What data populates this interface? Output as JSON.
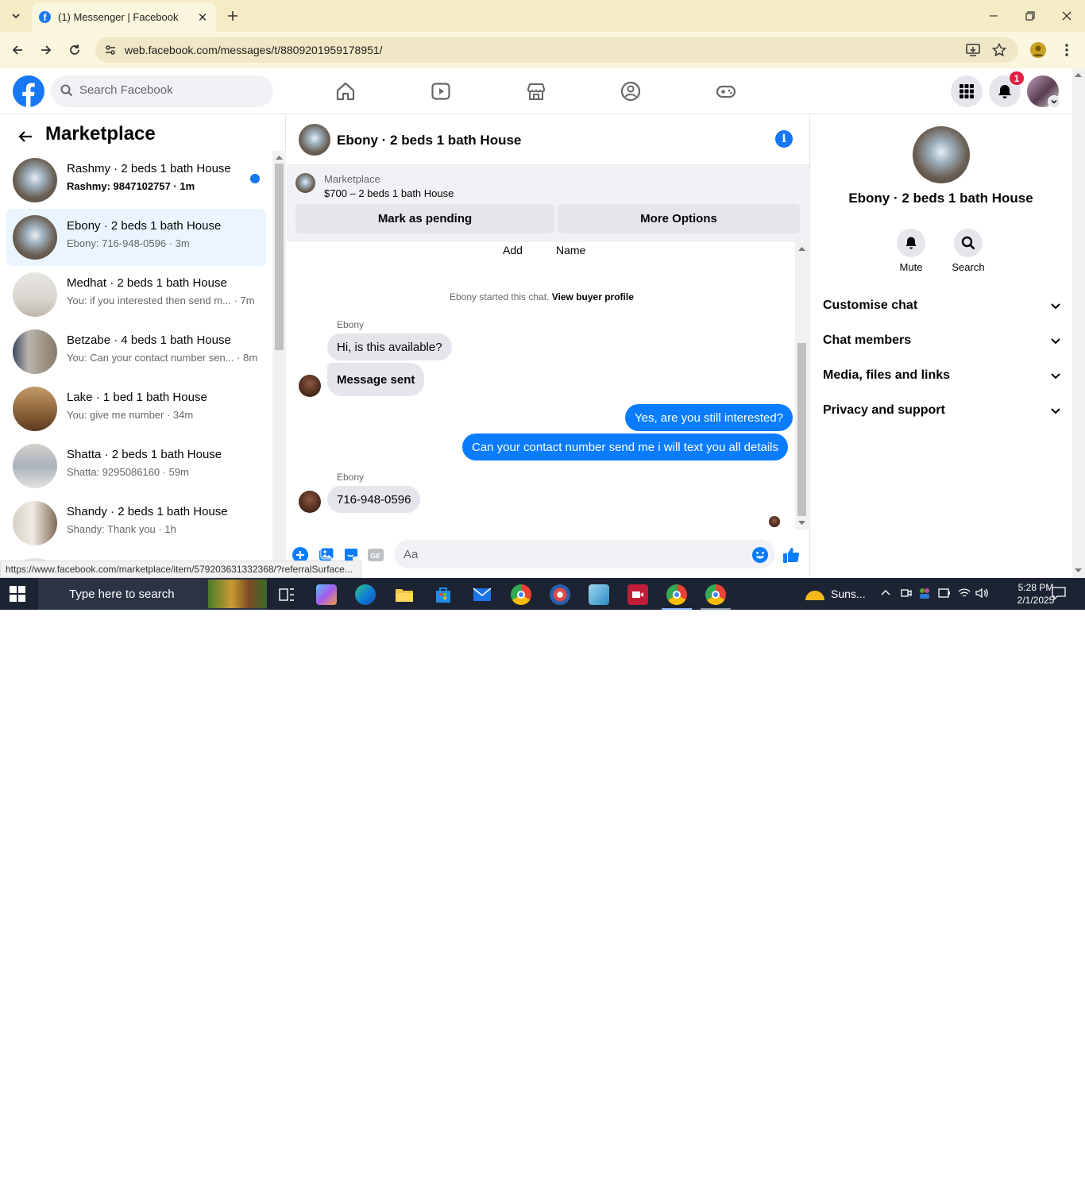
{
  "browser": {
    "tab_title": "(1) Messenger | Facebook",
    "url": "web.facebook.com/messages/t/8809201959178951/",
    "status_link": "https://www.facebook.com/marketplace/item/579203631332368/?referralSurface..."
  },
  "header": {
    "search_placeholder": "Search Facebook",
    "notification_count": "1"
  },
  "sidebar": {
    "title": "Marketplace",
    "conversations": [
      {
        "name": "Rashmy · 2 beds 1 bath House",
        "snippet": "Rashmy: 9847102757 · 1m",
        "unread": true
      },
      {
        "name": "Ebony · 2 beds 1 bath House",
        "snippet": "Ebony: 716-948-0596 · 3m",
        "selected": true
      },
      {
        "name": "Medhat · 2 beds 1 bath House",
        "snippet": "You: if you interested then send m... · 7m"
      },
      {
        "name": "Betzabe · 4 beds 1 bath House",
        "snippet": "You: Can your contact number sen... · 8m"
      },
      {
        "name": "Lake · 1 bed 1 bath House",
        "snippet": "You: give me number · 34m"
      },
      {
        "name": "Shatta · 2 beds 1 bath House",
        "snippet": "Shatta: 9295086160 · 59m"
      },
      {
        "name": "Shandy · 2 beds 1 bath House",
        "snippet": "Shandy: Thank you · 1h"
      }
    ]
  },
  "chat": {
    "title": "Ebony · 2 beds 1 bath House",
    "marketplace_label": "Marketplace",
    "listing": "$700 – 2 beds 1 bath House",
    "mark_pending": "Mark as pending",
    "more_options": "More Options",
    "top_labels": {
      "add": "Add",
      "name": "Name"
    },
    "started_text": "Ebony started this chat.",
    "view_profile": "View buyer profile",
    "sender": "Ebony",
    "messages": {
      "m1": "Hi, is this available?",
      "m2": "Message sent",
      "m3": "Yes, are you still interested?",
      "m4": "Can your contact number send me i will text you all details",
      "m5": "716-948-0596"
    },
    "composer_placeholder": "Aa"
  },
  "info_panel": {
    "name": "Ebony · 2 beds 1 bath House",
    "mute": "Mute",
    "search": "Search",
    "sections": [
      "Customise chat",
      "Chat members",
      "Media, files and links",
      "Privacy and support"
    ]
  },
  "taskbar": {
    "search_text": "Type here to search",
    "weather": "Suns...",
    "time": "5:28 PM",
    "date": "2/1/2025"
  },
  "colors": {
    "facebook_blue": "#1877f2",
    "messenger_blue": "#0a7cff",
    "chrome_tab_bar": "#f5ecc6"
  }
}
